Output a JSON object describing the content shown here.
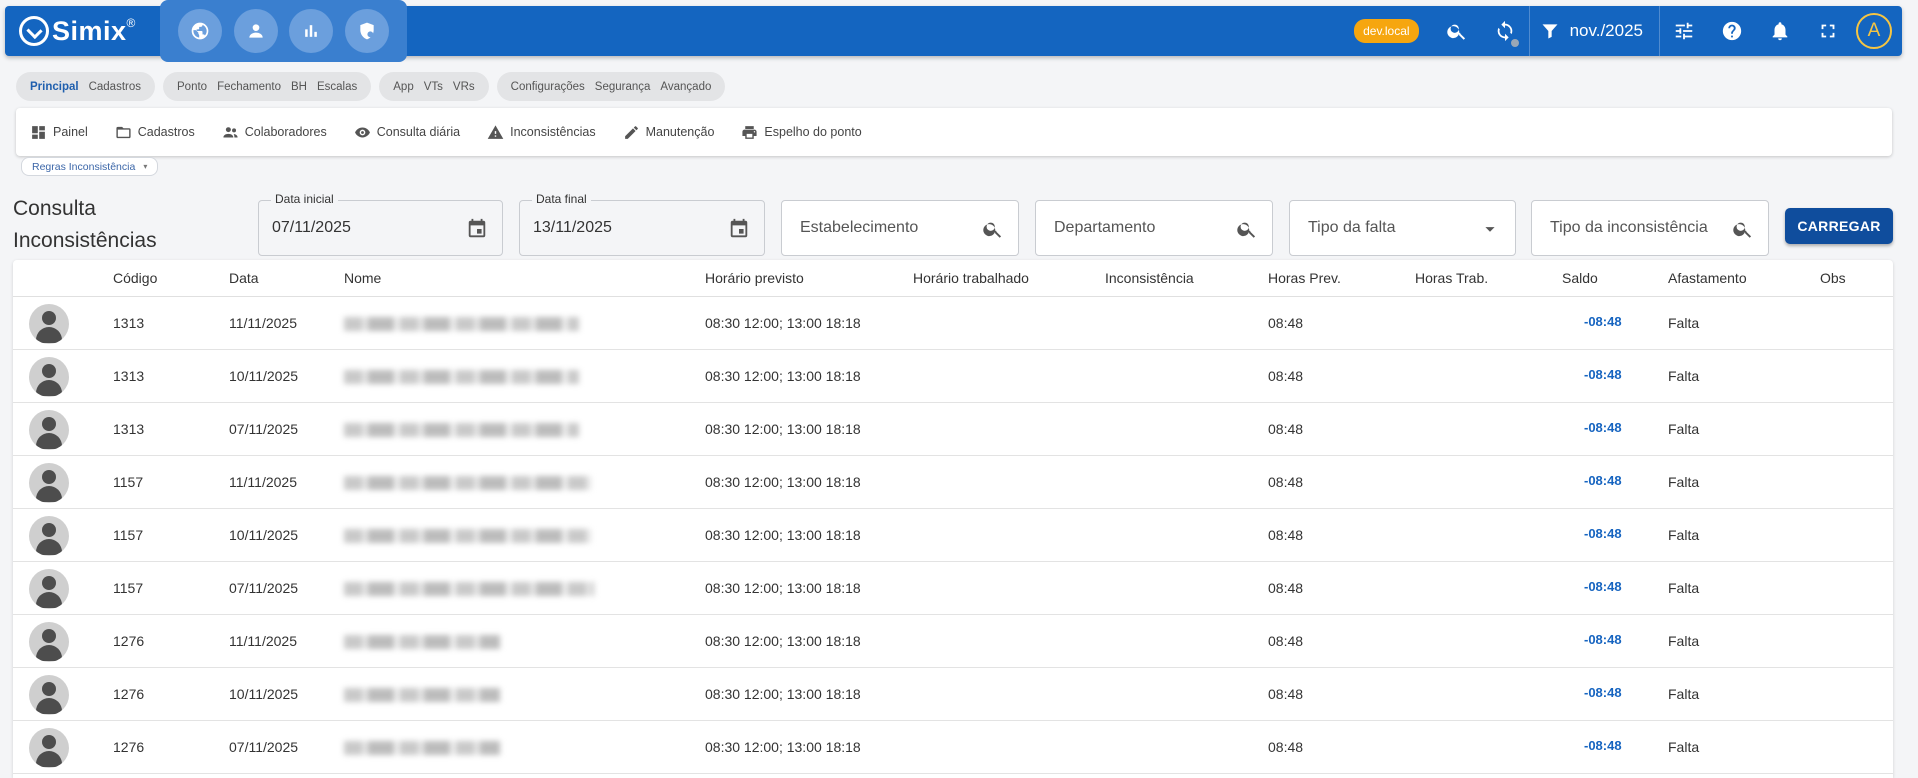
{
  "header": {
    "brand": "Simix",
    "brand_mark": "®",
    "env_badge": "dev.local",
    "period": "nov./2025",
    "user_initial": "A",
    "module_icons": [
      "globe-icon",
      "person-icon",
      "bar-chart-icon",
      "shield-icon"
    ]
  },
  "chip_groups": [
    {
      "items": [
        "Principal",
        "Cadastros"
      ],
      "active": 0
    },
    {
      "items": [
        "Ponto",
        "Fechamento",
        "BH",
        "Escalas"
      ],
      "active": -1
    },
    {
      "items": [
        "App",
        "VTs",
        "VRs"
      ],
      "active": -1
    },
    {
      "items": [
        "Configurações",
        "Segurança",
        "Avançado"
      ],
      "active": -1
    }
  ],
  "menu": [
    {
      "label": "Painel",
      "icon": "dashboard-icon"
    },
    {
      "label": "Cadastros",
      "icon": "folder-icon"
    },
    {
      "label": "Colaboradores",
      "icon": "people-icon"
    },
    {
      "label": "Consulta diária",
      "icon": "eye-icon"
    },
    {
      "label": "Inconsistências",
      "icon": "warning-icon"
    },
    {
      "label": "Manutenção",
      "icon": "pencil-icon"
    },
    {
      "label": "Espelho do ponto",
      "icon": "printer-icon"
    }
  ],
  "submenu": {
    "label": "Regras Inconsistência"
  },
  "page": {
    "title_line1": "Consulta",
    "title_line2": "Inconsistências"
  },
  "filters": {
    "data_inicial": {
      "label": "Data inicial",
      "value": "07/11/2025"
    },
    "data_final": {
      "label": "Data final",
      "value": "13/11/2025"
    },
    "estabelecimento": "Estabelecimento",
    "departamento": "Departamento",
    "tipo_falta": "Tipo da falta",
    "tipo_inconsistencia": "Tipo da inconsistência",
    "carregar": "CARREGAR"
  },
  "table": {
    "columns": [
      "Código",
      "Data",
      "Nome",
      "Horário previsto",
      "Horário trabalhado",
      "Inconsistência",
      "Horas Prev.",
      "Horas Trab.",
      "Saldo",
      "Afastamento",
      "Obs"
    ],
    "rows": [
      {
        "codigo": "1313",
        "data": "11/11/2025",
        "nome": "",
        "horario_previsto": "08:30 12:00; 13:00 18:18",
        "horas_prev": "08:48",
        "saldo": "-08:48",
        "afastamento": "Falta"
      },
      {
        "codigo": "1313",
        "data": "10/11/2025",
        "nome": "",
        "horario_previsto": "08:30 12:00; 13:00 18:18",
        "horas_prev": "08:48",
        "saldo": "-08:48",
        "afastamento": "Falta"
      },
      {
        "codigo": "1313",
        "data": "07/11/2025",
        "nome": "",
        "horario_previsto": "08:30 12:00; 13:00 18:18",
        "horas_prev": "08:48",
        "saldo": "-08:48",
        "afastamento": "Falta"
      },
      {
        "codigo": "1157",
        "data": "11/11/2025",
        "nome": "",
        "horario_previsto": "08:30 12:00; 13:00 18:18",
        "horas_prev": "08:48",
        "saldo": "-08:48",
        "afastamento": "Falta"
      },
      {
        "codigo": "1157",
        "data": "10/11/2025",
        "nome": "",
        "horario_previsto": "08:30 12:00; 13:00 18:18",
        "horas_prev": "08:48",
        "saldo": "-08:48",
        "afastamento": "Falta"
      },
      {
        "codigo": "1157",
        "data": "07/11/2025",
        "nome": "",
        "horario_previsto": "08:30 12:00; 13:00 18:18",
        "horas_prev": "08:48",
        "saldo": "-08:48",
        "afastamento": "Falta"
      },
      {
        "codigo": "1276",
        "data": "11/11/2025",
        "nome": "",
        "horario_previsto": "08:30 12:00; 13:00 18:18",
        "horas_prev": "08:48",
        "saldo": "-08:48",
        "afastamento": "Falta"
      },
      {
        "codigo": "1276",
        "data": "10/11/2025",
        "nome": "",
        "horario_previsto": "08:30 12:00; 13:00 18:18",
        "horas_prev": "08:48",
        "saldo": "-08:48",
        "afastamento": "Falta"
      },
      {
        "codigo": "1276",
        "data": "07/11/2025",
        "nome": "",
        "horario_previsto": "08:30 12:00; 13:00 18:18",
        "horas_prev": "08:48",
        "saldo": "-08:48",
        "afastamento": "Falta"
      }
    ]
  },
  "colors": {
    "primary": "#1465c0",
    "accent": "#f6a60f",
    "button": "#0f4d9d",
    "saldo": "#1664c0"
  }
}
